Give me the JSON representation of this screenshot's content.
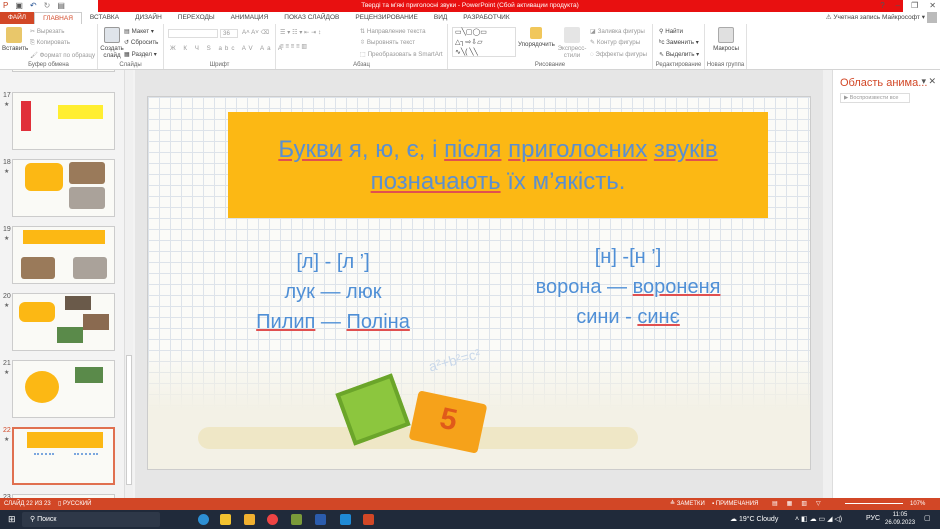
{
  "window": {
    "title": "Тверді та м'які приголосні звуки - PowerPoint (Сбой активации продукта)",
    "help": "?",
    "minimize": "–",
    "restore": "❐",
    "close": "✕"
  },
  "account": "Учетная запись Майкрософт",
  "tabs": [
    "ФАЙЛ",
    "ГЛАВНАЯ",
    "ВСТАВКА",
    "ДИЗАЙН",
    "ПЕРЕХОДЫ",
    "АНИМАЦИЯ",
    "ПОКАЗ СЛАЙДОВ",
    "РЕЦЕНЗИРОВАНИЕ",
    "ВИД",
    "РАЗРАБОТЧИК"
  ],
  "ribbon": {
    "clipboard": {
      "paste": "Вставить",
      "cut": "Вырезать",
      "copy": "Копировать",
      "format": "Формат по образцу",
      "label": "Буфер обмена"
    },
    "slides": {
      "new": "Создать слайд",
      "layout": "Макет",
      "reset": "Сбросить",
      "section": "Раздел",
      "label": "Слайды"
    },
    "font": {
      "size": "36",
      "label": "Шрифт"
    },
    "paragraph": {
      "direction": "Направление текста",
      "align": "Выровнять текст",
      "smartart": "Преобразовать в SmartArt",
      "label": "Абзац"
    },
    "drawing": {
      "arrange": "Упорядочить",
      "styles": "Экспресс-стили",
      "fill": "Заливка фигуры",
      "outline": "Контур фигуры",
      "effects": "Эффекты фигуры",
      "label": "Рисование"
    },
    "editing": {
      "find": "Найти",
      "replace": "Заменить",
      "select": "Выделить",
      "label": "Редактирование"
    },
    "newgroup": {
      "macros": "Макросы",
      "label": "Новая группа"
    }
  },
  "thumbnails": [
    {
      "num": "17"
    },
    {
      "num": "18"
    },
    {
      "num": "19"
    },
    {
      "num": "20"
    },
    {
      "num": "21"
    },
    {
      "num": "22",
      "selected": true
    },
    {
      "num": "23"
    }
  ],
  "slide": {
    "title_line1": [
      "Букви",
      " я, ю, є, і ",
      "після",
      " ",
      "приголосних",
      " ",
      "звуків"
    ],
    "title_line2": [
      "позначають",
      " їх м’якість."
    ],
    "left": {
      "h": "[л] - [л ’]",
      "r1": "лук — люк",
      "r2a": "Пилип",
      " r2b": "—",
      "r2c": "Поліна"
    },
    "right": {
      "h": "[н] -[н ’]",
      "r1a": "ворона —",
      "r1b": "вороненя",
      "r2a": "сини -",
      "r2b": "синє"
    },
    "formula": "a²+b²=c²",
    "book_number": "5"
  },
  "animation_pane": {
    "title": "Область анима...",
    "play_all": "Воспроизвести все"
  },
  "status": {
    "slide": "СЛАЙД 22 ИЗ 23",
    "lang": "РУССКИЙ",
    "notes": "ЗАМЕТКИ",
    "comments": "ПРИМЕЧАНИЯ",
    "zoom": "107%"
  },
  "taskbar": {
    "search": "Поиск",
    "weather": "19°C Cloudy",
    "lang": "РУС",
    "time": "11:05",
    "date": "26.09.2023"
  }
}
